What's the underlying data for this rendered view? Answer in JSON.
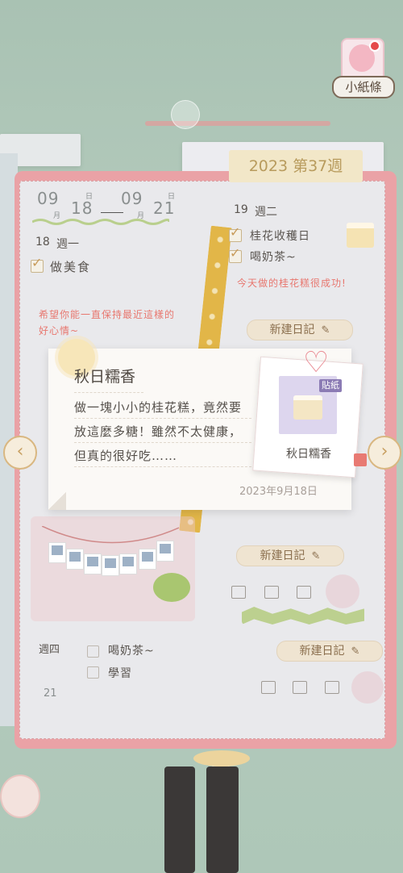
{
  "note": {
    "label": "小紙條"
  },
  "notebook": {
    "week_tab": "2023 第37週",
    "date_start": {
      "month": "09",
      "day": "18",
      "month_unit": "月",
      "day_unit": "日"
    },
    "date_end": {
      "month": "09",
      "day": "21",
      "month_unit": "月",
      "day_unit": "日"
    },
    "day18": {
      "date": "18",
      "weekday": "週一",
      "todos": [
        "做美食"
      ],
      "note": "希望你能一直保持最近這樣的好心情~"
    },
    "day19": {
      "date": "19",
      "weekday": "週二",
      "todos": [
        "桂花收穫日",
        "喝奶茶~"
      ],
      "note": "今天做的桂花糕很成功!"
    },
    "day21": {
      "weekday": "週四",
      "date": "21",
      "todos": [
        "喝奶茶~",
        "學習"
      ]
    },
    "new_diary_label": "新建日記"
  },
  "card": {
    "title": "秋日糯香",
    "lines": [
      "做一塊小小的桂花糕，竟然要",
      "放這麼多糖！雖然不太健康，",
      "但真的很好吃……"
    ],
    "date": "2023年9月18日",
    "sticker": {
      "badge": "貼紙",
      "name": "秋日糯香"
    }
  },
  "nav": {
    "prev_icon": "‹",
    "next_icon": "›"
  },
  "icons": {
    "pen": "✎",
    "gift": "🎁"
  },
  "colors": {
    "accent": "#eaa2a6",
    "tab": "#f2e7c8",
    "red_text": "#e8776f"
  }
}
